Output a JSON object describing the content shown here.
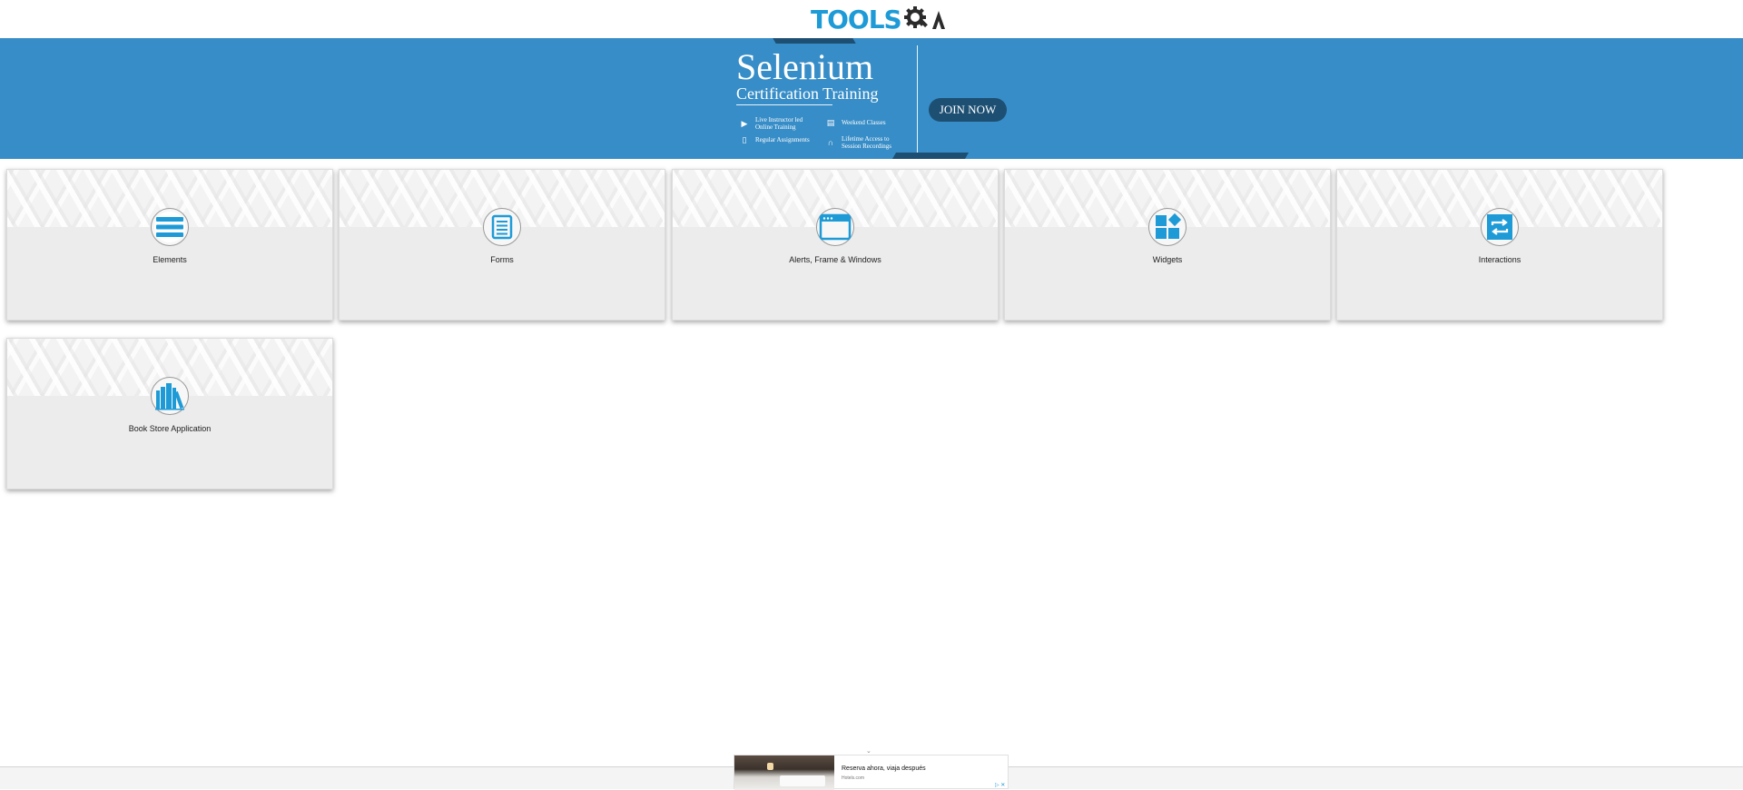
{
  "header": {
    "logo_text": "TOOLS",
    "logo_suffix": "QA"
  },
  "banner": {
    "title": "Selenium",
    "subtitle": "Certification Training",
    "features": [
      {
        "icon": "play-icon",
        "text": "Live Instructor led Online Training"
      },
      {
        "icon": "calendar-icon",
        "text": "Weekend Classes"
      },
      {
        "icon": "document-icon",
        "text": "Regular Assignments"
      },
      {
        "icon": "headphones-icon",
        "text": "Lifetime Access to Session Recordings"
      }
    ],
    "join_button": "JOIN NOW",
    "colors": {
      "background": "#378dc7",
      "accent_dark": "#1d4f73"
    }
  },
  "cards": [
    {
      "label": "Elements",
      "icon": "menu-lines-icon"
    },
    {
      "label": "Forms",
      "icon": "form-document-icon"
    },
    {
      "label": "Alerts, Frame & Windows",
      "icon": "browser-window-icon"
    },
    {
      "label": "Widgets",
      "icon": "widgets-grid-icon"
    },
    {
      "label": "Interactions",
      "icon": "repeat-arrows-icon"
    },
    {
      "label": "Book Store Application",
      "icon": "books-icon"
    }
  ],
  "ad": {
    "title": "Reserva ahora, viaja después",
    "source": "Hotels.com",
    "badge": "▷ ✕"
  },
  "colors": {
    "brand_blue": "#1e9bd7",
    "card_background": "#ececec"
  }
}
